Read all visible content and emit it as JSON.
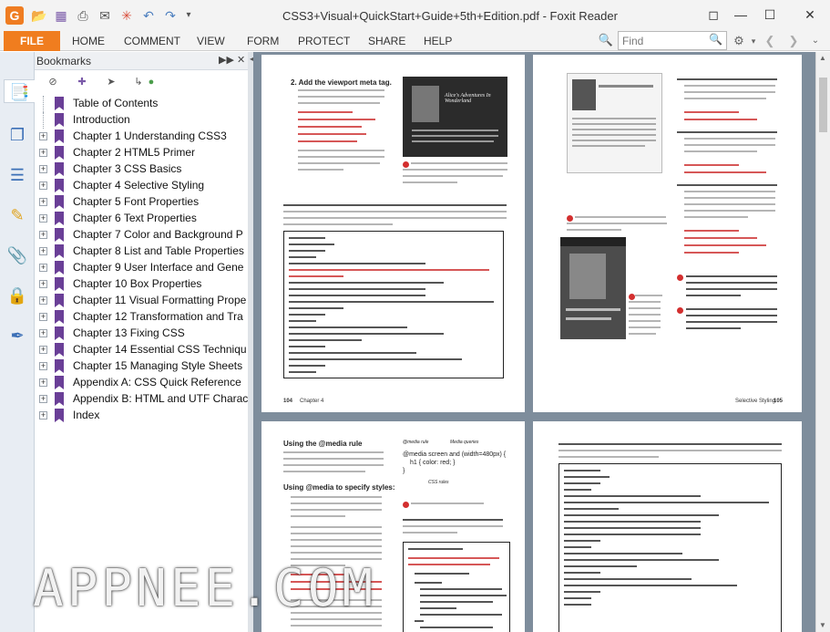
{
  "window": {
    "title": "CSS3+Visual+QuickStart+Guide+5th+Edition.pdf - Foxit Reader",
    "app_logo_letter": "G"
  },
  "quick_access": [
    {
      "name": "open-folder-icon",
      "glyph": "📂"
    },
    {
      "name": "save-icon",
      "glyph": "💾"
    },
    {
      "name": "print-icon",
      "glyph": "🖶"
    },
    {
      "name": "email-icon",
      "glyph": "✉"
    },
    {
      "name": "new-icon",
      "glyph": "✳"
    },
    {
      "name": "undo-icon",
      "glyph": "↶"
    },
    {
      "name": "redo-icon",
      "glyph": "↷"
    },
    {
      "name": "customize-dropdown-icon",
      "glyph": "▾"
    }
  ],
  "window_controls": {
    "restore": "🗗",
    "minimize": "─",
    "maximize": "☐",
    "close": "✕"
  },
  "menu": {
    "file": "FILE",
    "items": [
      "HOME",
      "COMMENT",
      "VIEW",
      "FORM",
      "PROTECT",
      "SHARE",
      "HELP"
    ]
  },
  "find": {
    "placeholder": "Find",
    "value": ""
  },
  "left_strip_icons": [
    "bookmark-panel-icon",
    "pages-icon",
    "layers-icon",
    "comments-icon",
    "attachments-icon",
    "security-icon",
    "signature-icon"
  ],
  "bookmarks": {
    "title": "Bookmarks",
    "items": [
      {
        "label": "Table of Contents",
        "expandable": false
      },
      {
        "label": "Introduction",
        "expandable": false
      },
      {
        "label": "Chapter 1 Understanding CSS3",
        "expandable": true
      },
      {
        "label": "Chapter 2 HTML5 Primer",
        "expandable": true
      },
      {
        "label": "Chapter 3 CSS Basics",
        "expandable": true
      },
      {
        "label": "Chapter 4 Selective Styling",
        "expandable": true
      },
      {
        "label": "Chapter 5 Font Properties",
        "expandable": true
      },
      {
        "label": "Chapter 6 Text Properties",
        "expandable": true
      },
      {
        "label": "Chapter 7 Color and Background P",
        "expandable": true
      },
      {
        "label": "Chapter 8 List and Table Properties",
        "expandable": true
      },
      {
        "label": "Chapter 9 User Interface and Gene",
        "expandable": true
      },
      {
        "label": "Chapter 10 Box Properties",
        "expandable": true
      },
      {
        "label": "Chapter 11 Visual Formatting Prope",
        "expandable": true
      },
      {
        "label": "Chapter 12 Transformation and Tra",
        "expandable": true
      },
      {
        "label": "Chapter 13 Fixing CSS",
        "expandable": true
      },
      {
        "label": "Chapter 14 Essential CSS Techniqu",
        "expandable": true
      },
      {
        "label": "Chapter 15 Managing Style Sheets",
        "expandable": true
      },
      {
        "label": "Appendix A: CSS Quick Reference",
        "expandable": true
      },
      {
        "label": "Appendix B: HTML and UTF Charac",
        "expandable": true
      },
      {
        "label": "Index",
        "expandable": true
      }
    ]
  },
  "pages": {
    "p104": {
      "step": "2. Add the viewport meta tag.",
      "fig_title": "Alice's Adventures In Wonderland",
      "footer_num": "104",
      "footer_chapter": "Chapter 4"
    },
    "p105": {
      "footer_num": "105",
      "footer_chapter": "Selective Styling"
    },
    "p106": {
      "heading": "Using the @media rule",
      "subheading": "Using @media to specify styles:",
      "diagram_at": "@media rule",
      "diagram_query": "Media queries",
      "diagram_code": "@media screen and (width=480px) {",
      "diagram_code2": "h1 { color: red; }",
      "diagram_code3": "}",
      "diagram_css": "CSS rules"
    }
  },
  "watermark": "APPNEE.COM",
  "colors": {
    "file_tab": "#f07d1f",
    "bookmark_flag": "#6a3f97",
    "doc_background": "#7e8d9c"
  }
}
